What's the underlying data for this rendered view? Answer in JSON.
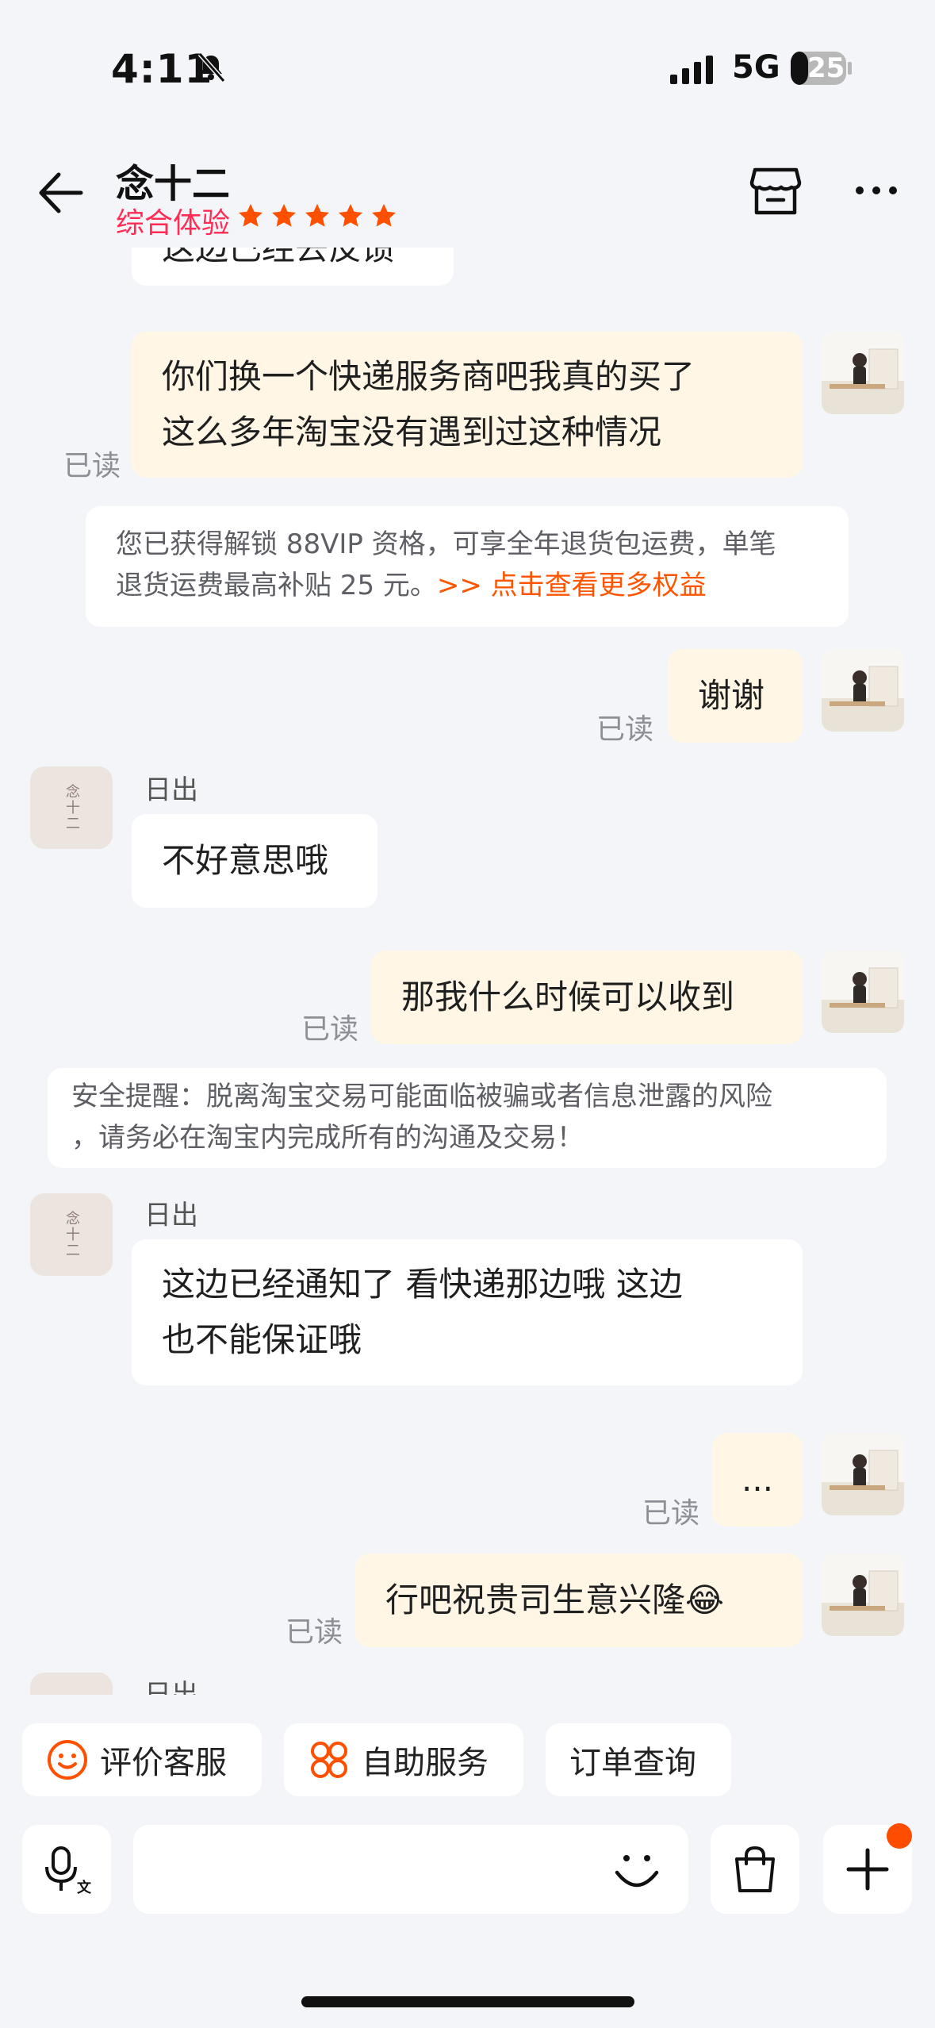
{
  "status_bar": {
    "time": "4:11",
    "network": "5G",
    "battery": "25"
  },
  "header": {
    "title": "念十二",
    "rating_label": "综合体验",
    "rating_stars": 5,
    "star_color": "#ff5000",
    "rating_label_color": "#ff2d55"
  },
  "messages": {
    "partial_top": "这边已经去反馈",
    "m1_line1": "你们换一个快递服务商吧我真的买了",
    "m1_line2": "这么多年淘宝没有遇到过这种情况",
    "read": "已读",
    "notice1_line1": "您已获得解锁 88VIP 资格，可享全年退货包运费，单笔",
    "notice1_line2": "退货运费最高补贴 25 元。",
    "notice1_link": ">> 点击查看更多权益",
    "m2": "谢谢",
    "sender": "日出",
    "m3": "不好意思哦",
    "m4": "那我什么时候可以收到",
    "notice2_line1": "安全提醒：脱离淘宝交易可能面临被骗或者信息泄露的风险",
    "notice2_line2": "，请务必在淘宝内完成所有的沟通及交易！",
    "m5_line1": "这边已经通知了 看快递那边哦 这边",
    "m5_line2": "也不能保证哦",
    "m6": "...",
    "m7": "行吧祝贵司生意兴隆😂",
    "shop_avatar_text": "念十二"
  },
  "quick_actions": {
    "rate": "评价客服",
    "self_service": "自助服务",
    "order_query": "订单查询"
  },
  "colors": {
    "accent": "#ff5000",
    "outgoing_bubble": "#fff6e6",
    "background": "#f3f5f8"
  }
}
